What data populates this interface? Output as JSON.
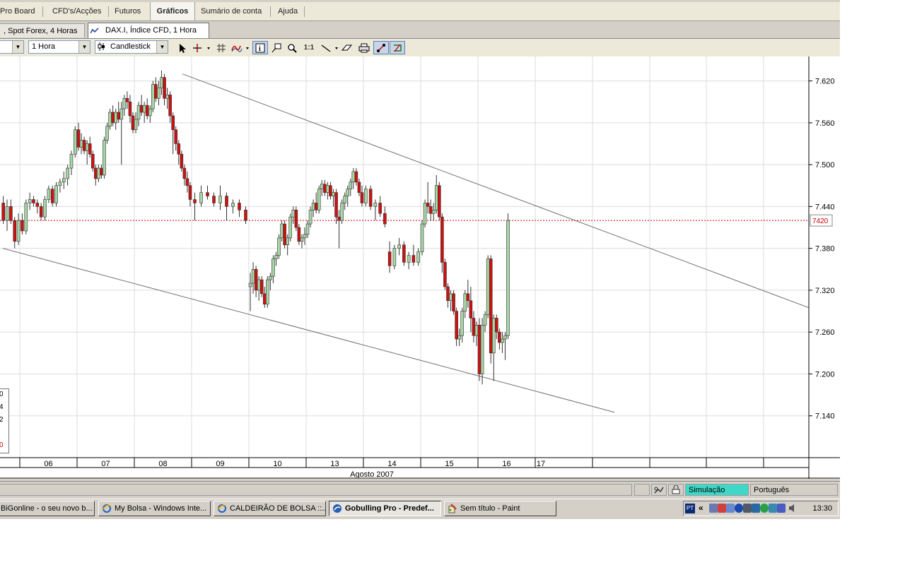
{
  "menu": {
    "tabs": [
      "Pro Board",
      "CFD's/Acções",
      "Futuros",
      "Gráficos",
      "Sumário de conta",
      "Ajuda"
    ],
    "active": "Gráficos"
  },
  "doc_tabs": {
    "inactive": ", Spot Forex, 4 Horas",
    "active": "DAX.I, Índice CFD, 1 Hora"
  },
  "toolbar": {
    "interval": "1 Hora",
    "chart_type": "Candlestick",
    "ratio_label": "1:1"
  },
  "chart_data": {
    "type": "candlestick",
    "instrument": "DAX.I",
    "interval": "1 Hora",
    "y_ticks": [
      "7.620",
      "7.560",
      "7.500",
      "7.440",
      "7.380",
      "7.320",
      "7.260",
      "7.200",
      "7.140"
    ],
    "ylim": [
      7080,
      7655
    ],
    "x_labels": [
      "06",
      "07",
      "08",
      "09",
      "10",
      "13",
      "14",
      "15",
      "16",
      "17"
    ],
    "month_label": "Agosto 2007",
    "current_price_label": "7420",
    "current_price": 7420,
    "legend_fragments": [
      "0",
      "4",
      "2",
      "0"
    ],
    "colors": {
      "up": "#a6d6a6",
      "down": "#cc1111",
      "line": "#707070",
      "price": "#cc0000"
    },
    "candles": [
      [
        7445,
        7455,
        7415,
        7420
      ],
      [
        7420,
        7450,
        7405,
        7440
      ],
      [
        7440,
        7450,
        7415,
        7420
      ],
      [
        7420,
        7425,
        7380,
        7390
      ],
      [
        7390,
        7430,
        7385,
        7420
      ],
      [
        7420,
        7430,
        7400,
        7405
      ],
      [
        7405,
        7450,
        7400,
        7445
      ],
      [
        7445,
        7460,
        7435,
        7450
      ],
      [
        7450,
        7455,
        7440,
        7445
      ],
      [
        7445,
        7450,
        7430,
        7440
      ],
      [
        7440,
        7445,
        7420,
        7425
      ],
      [
        7425,
        7455,
        7420,
        7450
      ],
      [
        7450,
        7470,
        7445,
        7465
      ],
      [
        7465,
        7470,
        7440,
        7445
      ],
      [
        7445,
        7475,
        7440,
        7470
      ],
      [
        7470,
        7480,
        7460,
        7475
      ],
      [
        7475,
        7490,
        7465,
        7480
      ],
      [
        7480,
        7500,
        7470,
        7495
      ],
      [
        7495,
        7520,
        7485,
        7515
      ],
      [
        7515,
        7555,
        7510,
        7550
      ],
      [
        7550,
        7560,
        7520,
        7525
      ],
      [
        7525,
        7545,
        7515,
        7535
      ],
      [
        7535,
        7540,
        7515,
        7520
      ],
      [
        7520,
        7535,
        7500,
        7530
      ],
      [
        7530,
        7540,
        7510,
        7515
      ],
      [
        7515,
        7520,
        7490,
        7495
      ],
      [
        7495,
        7500,
        7470,
        7480
      ],
      [
        7480,
        7500,
        7475,
        7495
      ],
      [
        7495,
        7500,
        7480,
        7485
      ],
      [
        7485,
        7540,
        7480,
        7535
      ],
      [
        7535,
        7560,
        7530,
        7555
      ],
      [
        7555,
        7580,
        7550,
        7575
      ],
      [
        7575,
        7585,
        7555,
        7560
      ],
      [
        7560,
        7580,
        7550,
        7575
      ],
      [
        7575,
        7590,
        7560,
        7565
      ],
      [
        7565,
        7590,
        7500,
        7580
      ],
      [
        7580,
        7600,
        7570,
        7595
      ],
      [
        7595,
        7605,
        7580,
        7590
      ],
      [
        7590,
        7600,
        7560,
        7570
      ],
      [
        7570,
        7575,
        7545,
        7550
      ],
      [
        7550,
        7575,
        7545,
        7565
      ],
      [
        7565,
        7590,
        7555,
        7585
      ],
      [
        7585,
        7600,
        7570,
        7575
      ],
      [
        7575,
        7590,
        7560,
        7585
      ],
      [
        7585,
        7595,
        7565,
        7570
      ],
      [
        7570,
        7585,
        7560,
        7580
      ],
      [
        7580,
        7620,
        7575,
        7615
      ],
      [
        7615,
        7625,
        7590,
        7595
      ],
      [
        7595,
        7620,
        7585,
        7610
      ],
      [
        7610,
        7635,
        7600,
        7625
      ],
      [
        7625,
        7630,
        7585,
        7595
      ],
      [
        7595,
        7610,
        7580,
        7600
      ],
      [
        7600,
        7605,
        7560,
        7570
      ],
      [
        7570,
        7575,
        7515,
        7550
      ],
      [
        7550,
        7555,
        7520,
        7530
      ],
      [
        7530,
        7535,
        7500,
        7515
      ],
      [
        7515,
        7520,
        7490,
        7495
      ],
      [
        7495,
        7500,
        7470,
        7480
      ],
      [
        7480,
        7490,
        7460,
        7470
      ],
      [
        7470,
        7475,
        7440,
        7450
      ],
      [
        7450,
        7460,
        7420,
        7445
      ],
      [
        7445,
        7470,
        7440,
        7460
      ],
      [
        7460,
        7470,
        7450,
        7455
      ],
      [
        7455,
        7460,
        7440,
        7445
      ],
      [
        7445,
        7470,
        7435,
        7455
      ],
      [
        7455,
        7460,
        7420,
        7440
      ],
      [
        7440,
        7450,
        7430,
        7445
      ],
      [
        7445,
        7450,
        7425,
        7435
      ],
      [
        7435,
        7440,
        7415,
        7420
      ],
      [
        7325,
        7345,
        7290,
        7330
      ],
      [
        7330,
        7360,
        7315,
        7350
      ],
      [
        7350,
        7355,
        7310,
        7320
      ],
      [
        7320,
        7340,
        7305,
        7335
      ],
      [
        7335,
        7340,
        7310,
        7315
      ],
      [
        7315,
        7325,
        7295,
        7300
      ],
      [
        7300,
        7340,
        7295,
        7335
      ],
      [
        7335,
        7345,
        7320,
        7340
      ],
      [
        7340,
        7370,
        7330,
        7365
      ],
      [
        7365,
        7375,
        7355,
        7370
      ],
      [
        7370,
        7400,
        7365,
        7395
      ],
      [
        7395,
        7420,
        7390,
        7415
      ],
      [
        7415,
        7420,
        7380,
        7385
      ],
      [
        7385,
        7400,
        7370,
        7395
      ],
      [
        7395,
        7430,
        7390,
        7425
      ],
      [
        7425,
        7440,
        7415,
        7435
      ],
      [
        7435,
        7440,
        7405,
        7410
      ],
      [
        7410,
        7415,
        7385,
        7390
      ],
      [
        7390,
        7400,
        7380,
        7395
      ],
      [
        7395,
        7410,
        7385,
        7400
      ],
      [
        7400,
        7420,
        7395,
        7415
      ],
      [
        7415,
        7440,
        7410,
        7435
      ],
      [
        7435,
        7450,
        7425,
        7445
      ],
      [
        7445,
        7460,
        7430,
        7435
      ],
      [
        7435,
        7470,
        7430,
        7465
      ],
      [
        7465,
        7478,
        7455,
        7472
      ],
      [
        7472,
        7478,
        7455,
        7460
      ],
      [
        7460,
        7475,
        7450,
        7470
      ],
      [
        7470,
        7475,
        7450,
        7455
      ],
      [
        7455,
        7465,
        7440,
        7460
      ],
      [
        7460,
        7465,
        7415,
        7425
      ],
      [
        7425,
        7435,
        7380,
        7420
      ],
      [
        7420,
        7450,
        7415,
        7445
      ],
      [
        7445,
        7460,
        7435,
        7455
      ],
      [
        7455,
        7470,
        7440,
        7465
      ],
      [
        7465,
        7480,
        7455,
        7475
      ],
      [
        7475,
        7495,
        7465,
        7490
      ],
      [
        7490,
        7495,
        7470,
        7475
      ],
      [
        7475,
        7480,
        7455,
        7460
      ],
      [
        7460,
        7470,
        7440,
        7445
      ],
      [
        7445,
        7470,
        7440,
        7465
      ],
      [
        7465,
        7470,
        7435,
        7440
      ],
      [
        7440,
        7450,
        7420,
        7445
      ],
      [
        7445,
        7455,
        7425,
        7430
      ],
      [
        7430,
        7440,
        7410,
        7415
      ],
      [
        7375,
        7390,
        7345,
        7355
      ],
      [
        7355,
        7385,
        7350,
        7380
      ],
      [
        7380,
        7395,
        7370,
        7385
      ],
      [
        7385,
        7390,
        7355,
        7360
      ],
      [
        7360,
        7375,
        7350,
        7370
      ],
      [
        7370,
        7385,
        7355,
        7360
      ],
      [
        7360,
        7380,
        7355,
        7375
      ],
      [
        7375,
        7420,
        7370,
        7415
      ],
      [
        7415,
        7450,
        7410,
        7445
      ],
      [
        7445,
        7475,
        7430,
        7440
      ],
      [
        7440,
        7450,
        7420,
        7430
      ],
      [
        7430,
        7445,
        7420,
        7435
      ],
      [
        7435,
        7485,
        7430,
        7470
      ],
      [
        7470,
        7475,
        7420,
        7425
      ],
      [
        7425,
        7430,
        7345,
        7360
      ],
      [
        7360,
        7365,
        7320,
        7325
      ],
      [
        7325,
        7330,
        7295,
        7305
      ],
      [
        7305,
        7320,
        7290,
        7315
      ],
      [
        7315,
        7320,
        7285,
        7290
      ],
      [
        7290,
        7295,
        7240,
        7250
      ],
      [
        7250,
        7265,
        7240,
        7255
      ],
      [
        7255,
        7295,
        7245,
        7290
      ],
      [
        7290,
        7320,
        7280,
        7315
      ],
      [
        7315,
        7335,
        7295,
        7305
      ],
      [
        7305,
        7325,
        7260,
        7280
      ],
      [
        7280,
        7290,
        7245,
        7255
      ],
      [
        7255,
        7275,
        7240,
        7270
      ],
      [
        7270,
        7280,
        7190,
        7200
      ],
      [
        7200,
        7280,
        7185,
        7270
      ],
      [
        7270,
        7290,
        7260,
        7285
      ],
      [
        7285,
        7370,
        7280,
        7365
      ],
      [
        7365,
        7370,
        7215,
        7230
      ],
      [
        7230,
        7285,
        7190,
        7280
      ],
      [
        7280,
        7285,
        7250,
        7260
      ],
      [
        7260,
        7265,
        7235,
        7245
      ],
      [
        7245,
        7260,
        7230,
        7250
      ],
      [
        7250,
        7260,
        7220,
        7255
      ],
      [
        7255,
        7430,
        7250,
        7420
      ]
    ],
    "candle_days": [
      "06",
      "06",
      "06",
      "06",
      "06",
      "06",
      "06",
      "06",
      "06",
      "06",
      "06",
      "06",
      "06",
      "06",
      "06",
      "06",
      "06",
      "06",
      "06",
      "06",
      "07",
      "07",
      "07",
      "07",
      "07",
      "07",
      "07",
      "07",
      "07",
      "07",
      "07",
      "07",
      "07",
      "07",
      "07",
      "07",
      "07",
      "07",
      "07",
      "07",
      "08",
      "08",
      "08",
      "08",
      "08",
      "08",
      "08",
      "08",
      "08",
      "08",
      "08",
      "08",
      "08",
      "08",
      "08",
      "08",
      "08",
      "08",
      "08",
      "08",
      "09",
      "09",
      "09",
      "09",
      "09",
      "09",
      "09",
      "09",
      "09",
      "10",
      "10",
      "10",
      "10",
      "10",
      "10",
      "10",
      "10",
      "10",
      "10",
      "10",
      "10",
      "10",
      "10",
      "10",
      "10",
      "10",
      "10",
      "10",
      "10",
      "13",
      "13",
      "13",
      "13",
      "13",
      "13",
      "13",
      "13",
      "13",
      "13",
      "13",
      "13",
      "13",
      "13",
      "13",
      "13",
      "13",
      "13",
      "13",
      "13",
      "14",
      "14",
      "14",
      "14",
      "14",
      "14",
      "14",
      "14",
      "14",
      "14",
      "14",
      "14",
      "15",
      "15",
      "15",
      "15",
      "15",
      "15",
      "15",
      "15",
      "15",
      "15",
      "15",
      "15",
      "15",
      "15",
      "15",
      "15",
      "15",
      "15",
      "15",
      "15",
      "16",
      "16",
      "16",
      "16",
      "16",
      "16",
      "16",
      "16",
      "16",
      "16",
      "16",
      "16",
      "16",
      "16",
      "16",
      "16",
      "16",
      "16",
      "16",
      "16",
      "17",
      "17",
      "17",
      "17",
      "17",
      "17",
      "17",
      "17"
    ],
    "trendlines": [
      {
        "name": "upper-trendline",
        "start": [
          7630,
          "08"
        ],
        "end": [
          7295,
          "after-17"
        ]
      },
      {
        "name": "lower-trendline",
        "start": [
          7380,
          "06"
        ],
        "end": [
          7145,
          "after-17"
        ]
      }
    ]
  },
  "statusbar": {
    "mode": "Simulação",
    "language": "Português"
  },
  "taskbar": {
    "buttons": [
      {
        "label": "BiGonline - o seu novo b...",
        "active": false
      },
      {
        "label": "My Bolsa - Windows Inte...",
        "active": false
      },
      {
        "label": "CALDEIRÃO DE BOLSA ::...",
        "active": false
      },
      {
        "label": "Gobulling Pro - Predef...",
        "active": true
      },
      {
        "label": "Sem título - Paint",
        "active": false
      }
    ],
    "tray_lang": "PT",
    "tray_chevron": "«",
    "clock": "13:30"
  }
}
